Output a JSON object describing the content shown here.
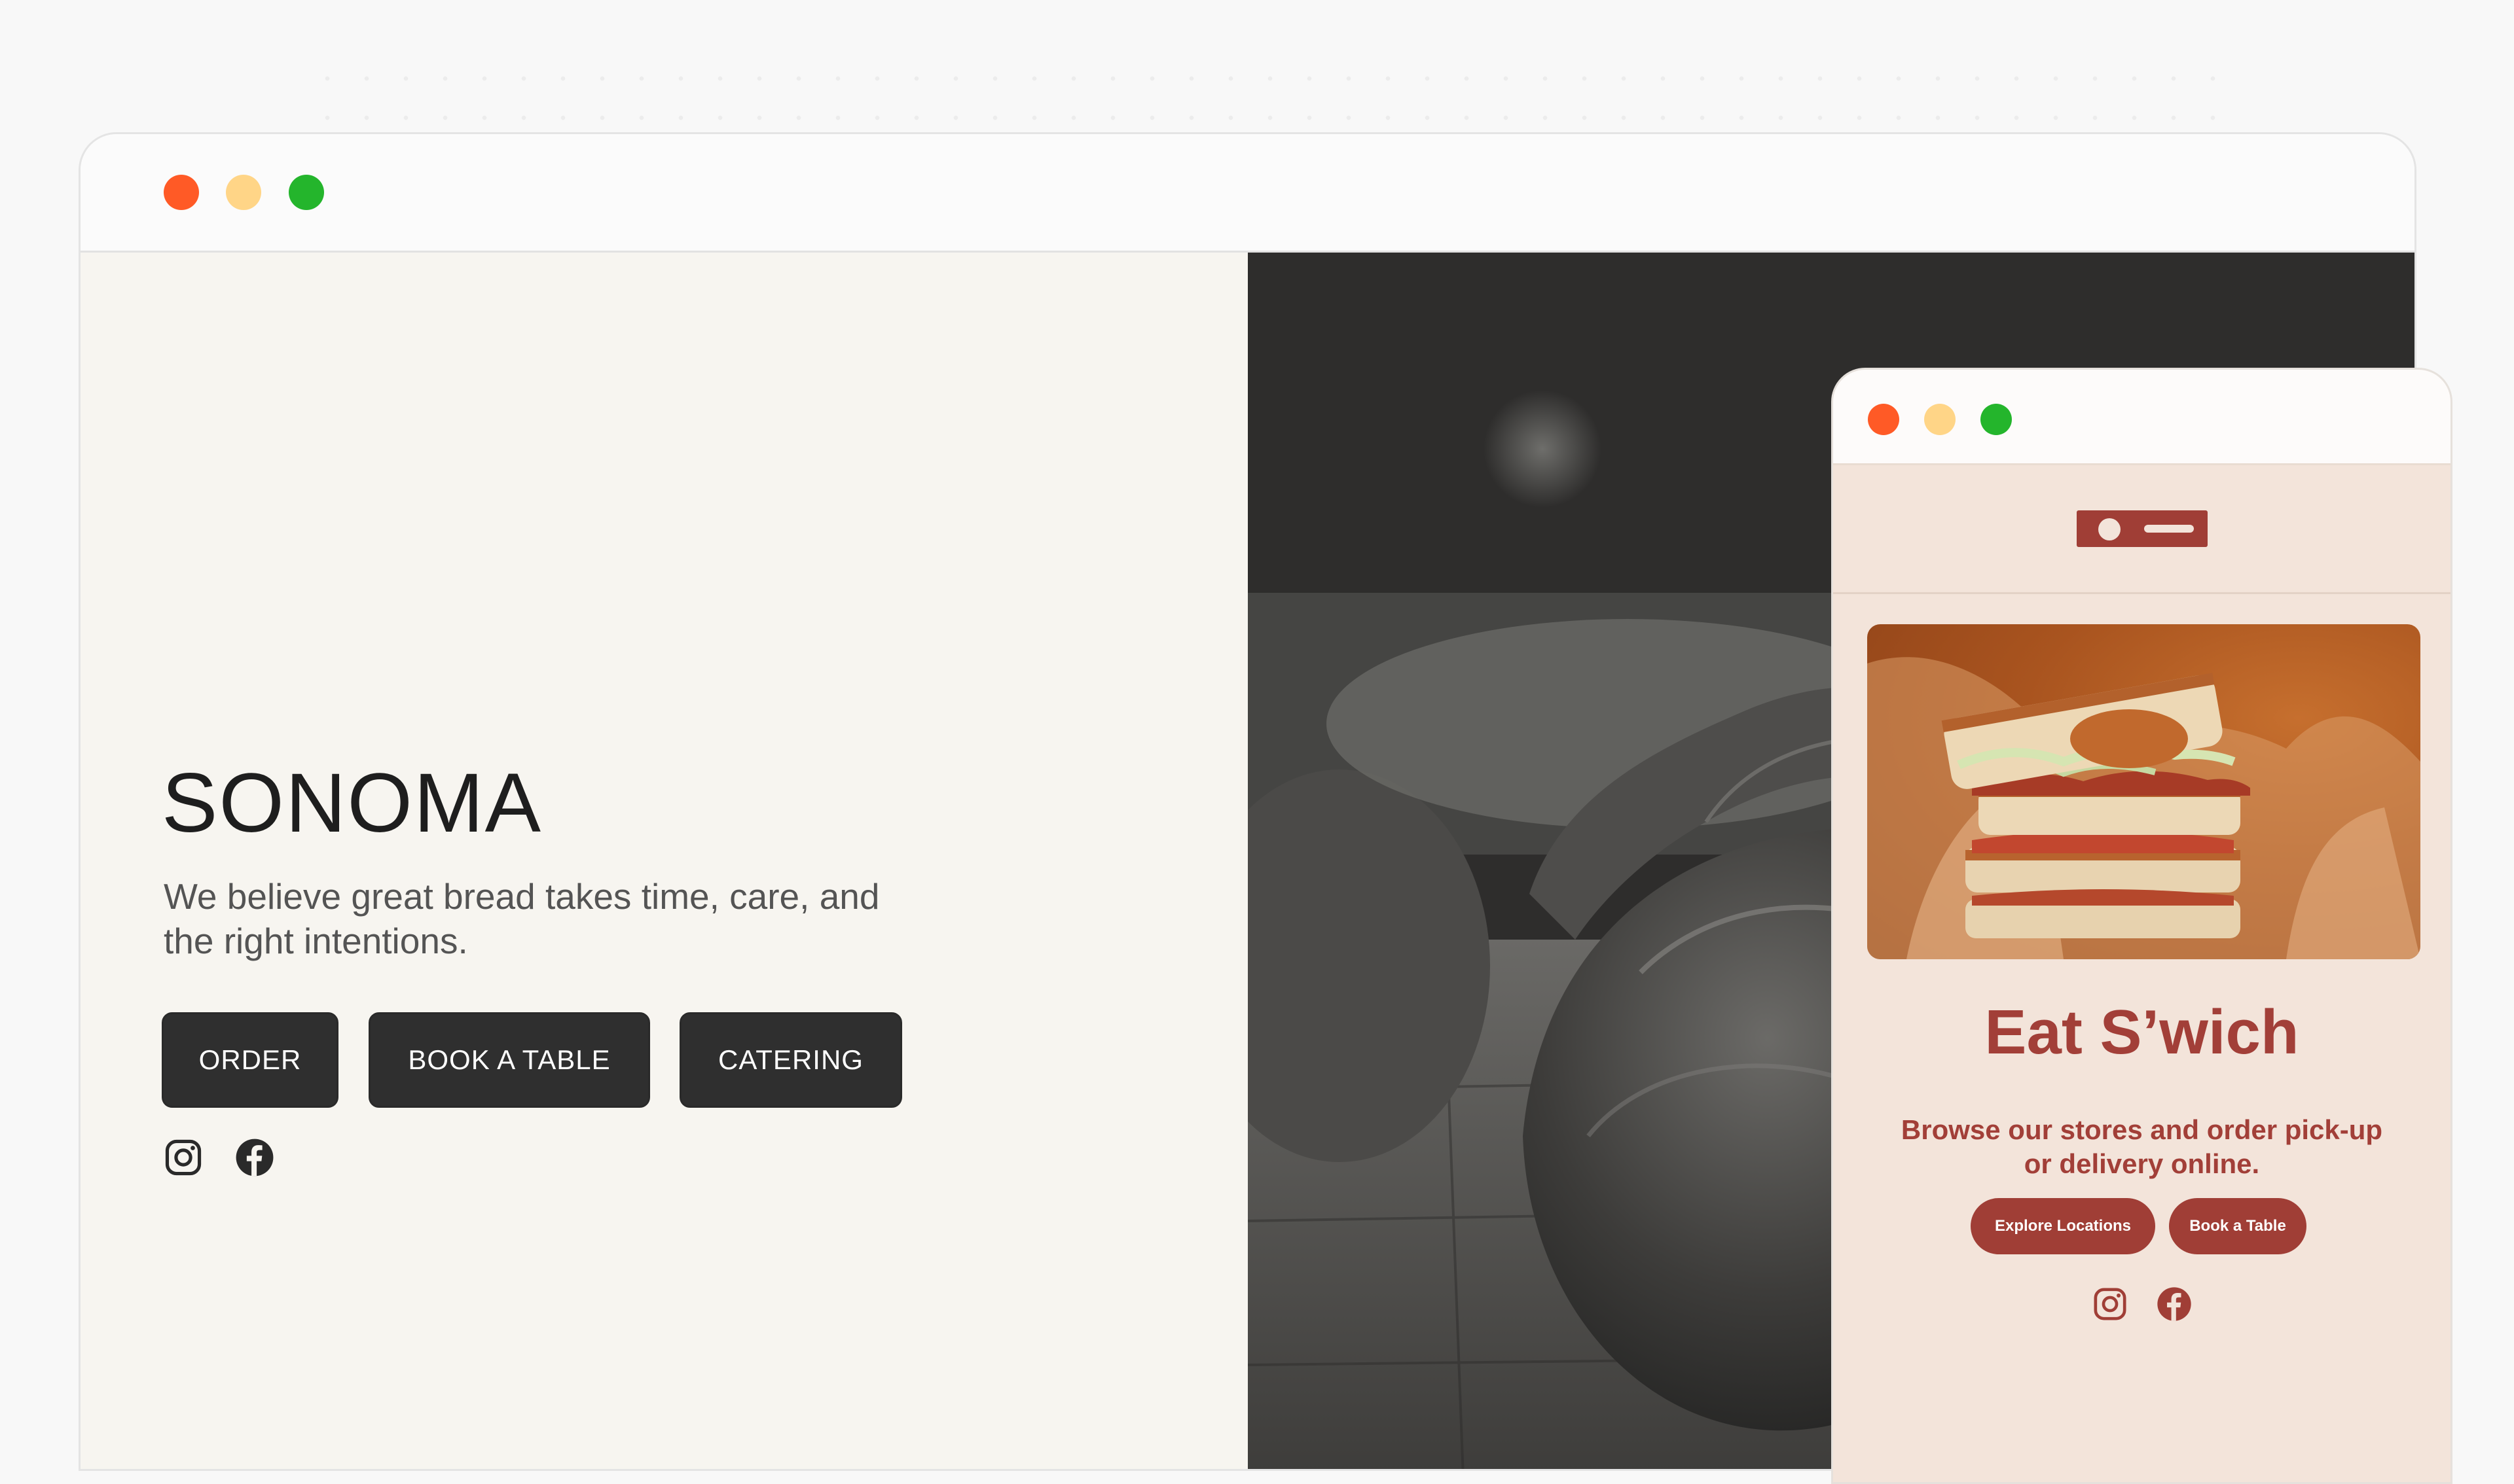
{
  "main_window": {
    "brand": "SONOMA",
    "tagline": "We believe great bread takes time, care, and the right intentions.",
    "buttons": {
      "order": "ORDER",
      "book_table": "BOOK A TABLE",
      "catering": "CATERING"
    },
    "social_icons": [
      "instagram-icon",
      "facebook-icon"
    ],
    "hero_image": "black-and-white bread loaves photo"
  },
  "mini_window": {
    "title": "Eat S’wich",
    "subtitle": "Browse our stores and order pick-up or delivery online.",
    "buttons": {
      "explore": "Explore Locations",
      "book": "Book a Table"
    },
    "social_icons": [
      "instagram-icon",
      "facebook-icon"
    ],
    "hero_image": "stacked sandwich photo"
  },
  "colors": {
    "traffic_red": "#ff5a26",
    "traffic_yellow": "#ffd587",
    "traffic_green": "#24b52c",
    "dark_button": "#2f2f2f",
    "accent_brick": "#a03e36",
    "mini_background": "#f3e4da",
    "left_background": "#f7f5f0"
  }
}
